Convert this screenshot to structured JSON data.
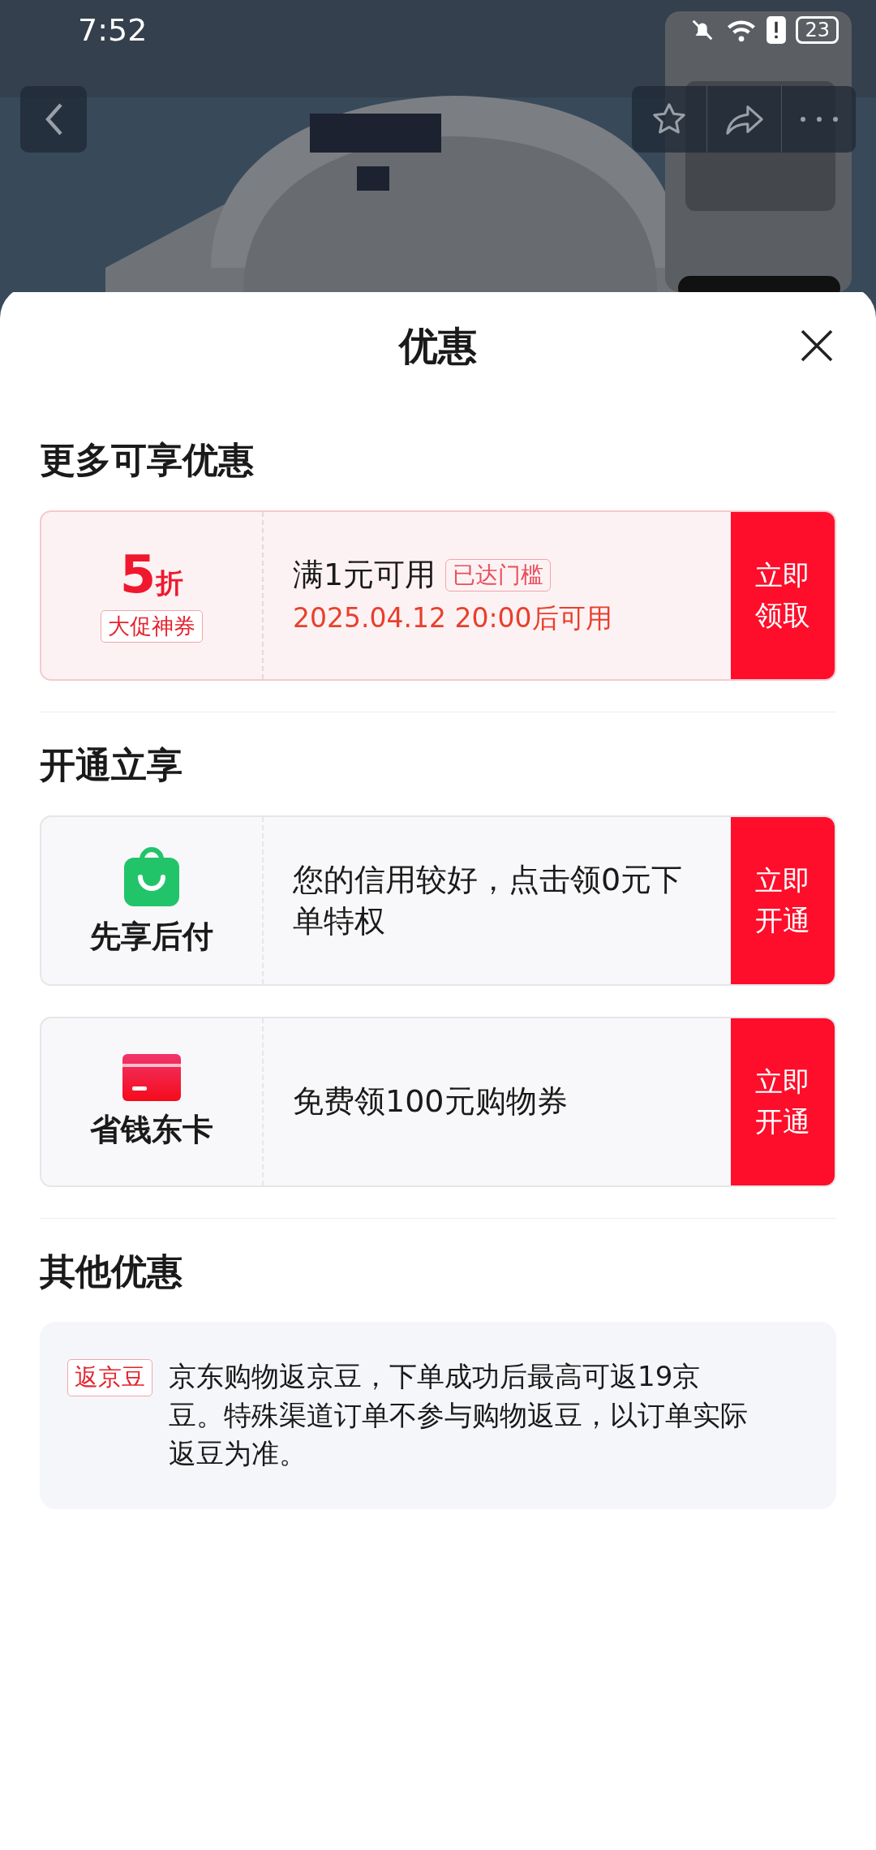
{
  "status_bar": {
    "time": "7:52",
    "battery": "23"
  },
  "sheet": {
    "title": "优惠"
  },
  "sections": [
    {
      "heading": "更多可享优惠",
      "items": [
        {
          "kind": "coupon",
          "value": "5",
          "unit": "折",
          "tag": "大促神券",
          "condition": "满1元可用",
          "badge": "已达门槛",
          "validity": "2025.04.12 20:00后可用",
          "button": "立即领取"
        }
      ]
    },
    {
      "heading": "开通立享",
      "items": [
        {
          "kind": "service",
          "name": "先享后付",
          "description": "您的信用较好，点击领0元下单特权",
          "button": "立即开通"
        },
        {
          "kind": "service",
          "name": "省钱东卡",
          "description": "免费领100元购物券",
          "button": "立即开通"
        }
      ]
    },
    {
      "heading": "其他优惠",
      "items": [
        {
          "kind": "note",
          "tag": "返京豆",
          "text": "京东购物返京豆，下单成功后最高可返19京豆。特殊渠道订单不参与购物返豆，以订单实际返豆为准。"
        }
      ]
    }
  ]
}
